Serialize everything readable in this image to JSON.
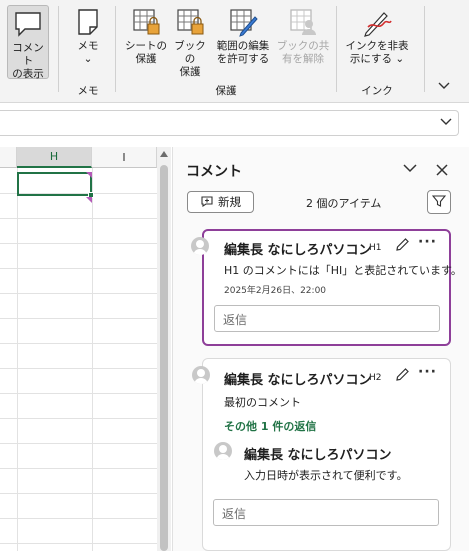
{
  "ribbon": {
    "show_comments": [
      "コメント",
      "の表示"
    ],
    "memo": [
      "メモ",
      "⌄"
    ],
    "protect_sheet": [
      "シートの",
      "保護"
    ],
    "protect_book": [
      "ブックの",
      "保護"
    ],
    "allow_edit_ranges": [
      "範囲の編集",
      "を許可する"
    ],
    "unshare_book": [
      "ブックの共",
      "有を解除"
    ],
    "hide_ink": [
      "インクを非表",
      "示にする ⌄"
    ],
    "groups": {
      "memo": "メモ",
      "protect": "保護",
      "ink": "インク"
    },
    "collapse_icon": "chevron-down"
  },
  "sheet": {
    "columns": [
      "H",
      "I"
    ],
    "selected_column": "H"
  },
  "comments_pane": {
    "title": "コメント",
    "new_button": "新規",
    "item_count": "2 個のアイテム",
    "threads": [
      {
        "author": "編集長 なにしろパソコン",
        "cell": "H1",
        "text": "H1 のコメントには「HI」と表記されています。",
        "timestamp": "2025年2月26日、22:00",
        "reply_placeholder": "返信"
      },
      {
        "author": "編集長 なにしろパソコン",
        "cell": "H2",
        "text": "最初のコメント",
        "more_replies": "その他 1 件の返信",
        "reply": {
          "author": "編集長 なにしろパソコン",
          "text": "入力日時が表示されて便利です。"
        },
        "reply_placeholder": "返信"
      }
    ]
  },
  "colors": {
    "accent_excel": "#217346",
    "active_card": "#8e3f99",
    "comment_marker": "#b45ab8"
  }
}
